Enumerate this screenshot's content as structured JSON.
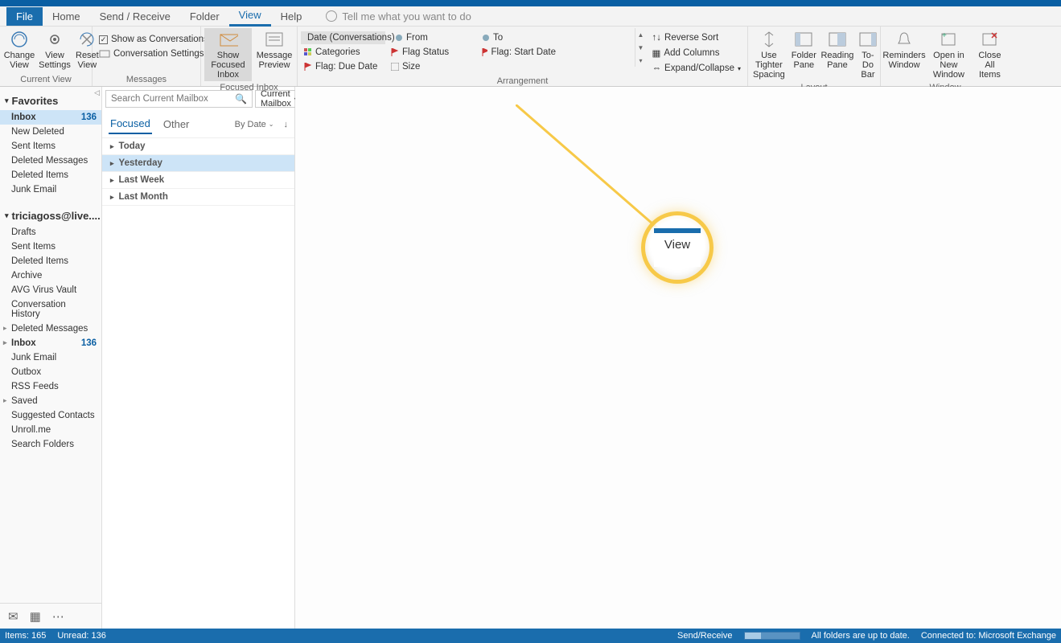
{
  "tabs": {
    "file": "File",
    "home": "Home",
    "sendreceive": "Send / Receive",
    "folder": "Folder",
    "view": "View",
    "help": "Help"
  },
  "tellme": "Tell me what you want to do",
  "ribbon": {
    "currentview": {
      "change": "Change View",
      "settings": "View Settings",
      "reset": "Reset View",
      "label": "Current View"
    },
    "messages": {
      "showconv": "Show as Conversations",
      "convsettings": "Conversation Settings",
      "label": "Messages"
    },
    "focused": {
      "showfocused": "Show Focused Inbox",
      "preview": "Message Preview",
      "label": "Focused Inbox"
    },
    "arrangement": {
      "date": "Date (Conversations)",
      "from": "From",
      "to": "To",
      "categories": "Categories",
      "flagstatus": "Flag Status",
      "flagstart": "Flag: Start Date",
      "flagdue": "Flag: Due Date",
      "size": "Size",
      "reverse": "Reverse Sort",
      "addcols": "Add Columns",
      "expand": "Expand/Collapse",
      "label": "Arrangement"
    },
    "layout": {
      "spacing": "Use Tighter Spacing",
      "folder": "Folder Pane",
      "reading": "Reading Pane",
      "todo": "To-Do Bar",
      "label": "Layout"
    },
    "window": {
      "reminders": "Reminders Window",
      "newwin": "Open in New Window",
      "close": "Close All Items",
      "label": "Window"
    }
  },
  "nav": {
    "favorites": "Favorites",
    "fav_items": [
      {
        "label": "Inbox",
        "count": "136",
        "bold": true,
        "selected": true
      },
      {
        "label": "New Deleted"
      },
      {
        "label": "Sent Items"
      },
      {
        "label": "Deleted Messages"
      },
      {
        "label": "Deleted Items"
      },
      {
        "label": "Junk Email"
      }
    ],
    "account": "triciagoss@live....",
    "acct_items": [
      {
        "label": "Drafts"
      },
      {
        "label": "Sent Items"
      },
      {
        "label": "Deleted Items"
      },
      {
        "label": "Archive"
      },
      {
        "label": "AVG Virus Vault"
      },
      {
        "label": "Conversation History"
      },
      {
        "label": "Deleted Messages",
        "exp": true
      },
      {
        "label": "Inbox",
        "count": "136",
        "bold": true,
        "exp": true
      },
      {
        "label": "Junk Email"
      },
      {
        "label": "Outbox"
      },
      {
        "label": "RSS Feeds"
      },
      {
        "label": "Saved",
        "exp": true
      },
      {
        "label": "Suggested Contacts"
      },
      {
        "label": "Unroll.me"
      },
      {
        "label": "Search Folders"
      }
    ]
  },
  "search": {
    "placeholder": "Search Current Mailbox",
    "scope": "Current Mailbox"
  },
  "inbox_tabs": {
    "focused": "Focused",
    "other": "Other",
    "bydate": "By Date"
  },
  "date_groups": [
    "Today",
    "Yesterday",
    "Last Week",
    "Last Month"
  ],
  "callout_label": "View",
  "status": {
    "items": "Items: 165",
    "unread": "Unread: 136",
    "sendreceive": "Send/Receive",
    "uptodate": "All folders are up to date.",
    "connected": "Connected to: Microsoft Exchange"
  }
}
